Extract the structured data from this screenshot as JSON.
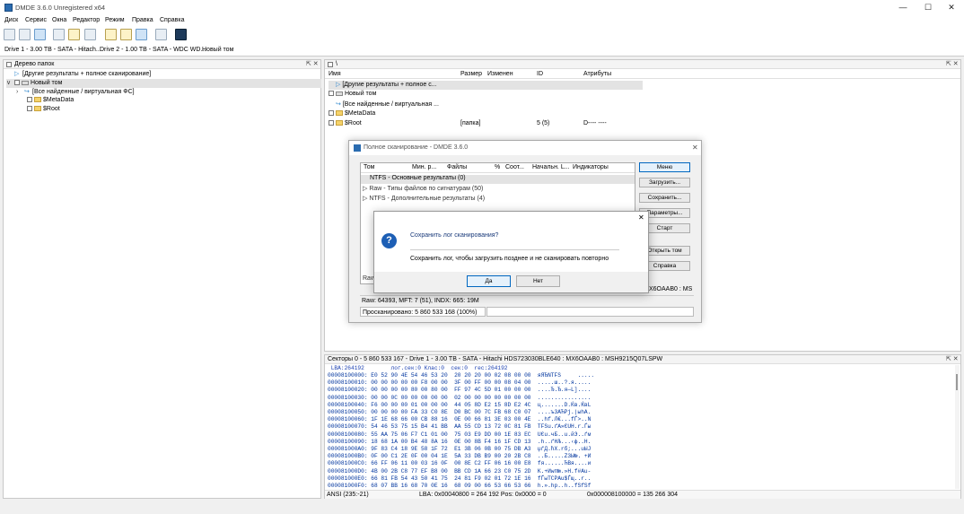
{
  "window": {
    "title": "DMDE 3.6.0 Unregistered x64",
    "controls": [
      "—",
      "☐",
      "✕"
    ]
  },
  "menu": [
    "Диск",
    "Сервис",
    "Окна",
    "Редактор",
    "Режим",
    "Правка",
    "Справка"
  ],
  "tabs": [
    "Drive 1 - 3.00 TB - SATA - Hitach...",
    "Drive 2 - 1.00 TB - SATA - WDC WD...",
    "Новый том"
  ],
  "left_panel": {
    "title": "Дерево папок",
    "ctl": "⇱ ✕",
    "items": [
      {
        "text": "[Другие результаты + полное сканирование]"
      },
      {
        "text": "Новый том"
      },
      {
        "text": "[Все найденные / виртуальная ФС]"
      },
      {
        "text": "$MetaData"
      },
      {
        "text": "$Root"
      }
    ]
  },
  "right_panel": {
    "title": "\\",
    "ctl": "⇱ ✕",
    "columns": [
      "Имя",
      "Размер",
      "Изменен",
      "ID",
      "Атрибуты"
    ],
    "rows": [
      {
        "name": "[Другие результаты + полное с...",
        "size": "",
        "changed": "",
        "id": "",
        "attr": ""
      },
      {
        "name": "Новый том",
        "size": "",
        "changed": "",
        "id": "",
        "attr": ""
      },
      {
        "name": "[Все найденные / виртуальная ...",
        "size": "",
        "changed": "",
        "id": "",
        "attr": ""
      },
      {
        "name": "$MetaData",
        "size": "",
        "changed": "",
        "id": "",
        "attr": ""
      },
      {
        "name": "$Root",
        "size": "[папка]",
        "changed": "",
        "id": "5 (5)",
        "attr": "D---- ----"
      }
    ]
  },
  "scan_dialog": {
    "title": "Полное сканирование - DMDE 3.6.0",
    "close": "✕",
    "columns": [
      "Том",
      "Мин. р...",
      "Файлы",
      "%",
      "Соот...",
      "Начальн. L...",
      "Индикаторы"
    ],
    "rows": [
      "NTFS - Основные результаты (0)",
      "Raw - Типы файлов по сигнатурам (50)",
      "NTFS - Дополнительные результаты (4)"
    ],
    "buttons": [
      "Меню",
      "Загрузить...",
      "Сохранить...",
      "Параметры...",
      "Старт",
      "Открыть том",
      "Справка"
    ],
    "footer_left": "Raw",
    "footer_right": "X6OAAB0 : MS",
    "status1": "Raw: 64393, MFT: 7 (51), INDX: 665: 19M",
    "status2": "Просканировано: 5 860 533 168 (100%)"
  },
  "confirm_dialog": {
    "close": "✕",
    "question": "Сохранить лог сканирования?",
    "detail": "Сохранить лог, чтобы загрузить позднее и не сканировать повторно",
    "yes": "Да",
    "no": "Нет"
  },
  "hex_panel": {
    "title": "Секторы 0 - 5 860 533 167 - Drive 1 - 3.00 TB - SATA - Hitachi HDS723030BLE640 : MX6OAAB0 : MSH9215Q07LSPW",
    "ctl": "⇱ ✕",
    "header": " LBA:264192        лог.сек:0 Клас:0  сек:0  rec:264192",
    "lines": [
      "00008100000: E0 52 90 4E 54 46 53 20  20 20 20 00 02 08 00 00  яЯЂNTFS     .....",
      "00008100010: 00 00 00 00 00 F8 00 00  3F 00 FF 00 00 08 04 00  .....ш..?.я.....",
      "00008100020: 00 00 00 00 80 00 80 00  FF 97 4C 5D 01 00 00 00  ....Ђ.Ђ.я—L]....",
      "00008100030: 00 00 0C 00 00 00 00 00  02 00 00 00 00 00 00 00  ................",
      "00008100040: F6 00 00 00 01 00 00 00  44 05 8D E2 15 8D E2 4C  ц.......D.Ќв.ЌвL",
      "00008100050: 00 00 00 00 FA 33 C0 8E  D0 BC 00 7C FB 68 C0 07  ....ъ3АЋРј.|ыhА.",
      "00008100060: 1F 1E 68 66 00 CB 88 16  0E 00 66 81 3E 03 00 4E  ..hf.Л€...fЃ>..N",
      "00008100070: 54 46 53 75 15 B4 41 BB  AA 55 CD 13 72 0C 81 FB  TFSu.ґA»ЄUН.r.Ѓы",
      "00008100080: 55 AA 75 06 F7 C1 01 00  75 03 E9 DD 00 1E 83 EC  UЄu.чБ..u.йЭ..ѓм",
      "00008100090: 18 68 1A 00 B4 48 8A 16  0E 00 8B F4 16 1F CD 13  .h..ґHЉ...‹ф..Н.",
      "000081000A0: 9F 83 C4 18 9E 58 1F 72  E1 3B 06 0B 00 75 DB A3  џѓД.ћX.rб;...uЫЈ",
      "000081000B0: 0F 00 C1 2E 0F 00 04 1E  5A 33 DB B9 00 20 2B C8  ..Б.....Z3Ы№. +И",
      "000081000C0: 66 FF 06 11 00 03 16 0F  00 8E C2 FF 06 16 00 E8  fя......ЋВя....и",
      "000081000D0: 4B 00 2B C8 77 EF B8 00  BB CD 1A 66 23 C0 75 2D  K.+Иwп№.»Н.f#Аu-",
      "000081000E0: 66 81 FB 54 43 50 41 75  24 81 F9 02 01 72 1E 16  fЃыTCPAu$Ѓщ..r..",
      "000081000F0: 68 07 BB 16 68 70 0E 16  68 09 00 66 53 66 53 66  h.».hp..h..fSfSf"
    ],
    "status": [
      "ANSI (235:-21)",
      "LBA: 0x00040800 = 264 192  Pos: 0x0000 = 0",
      "0x000008100000 = 135 266 304"
    ]
  }
}
